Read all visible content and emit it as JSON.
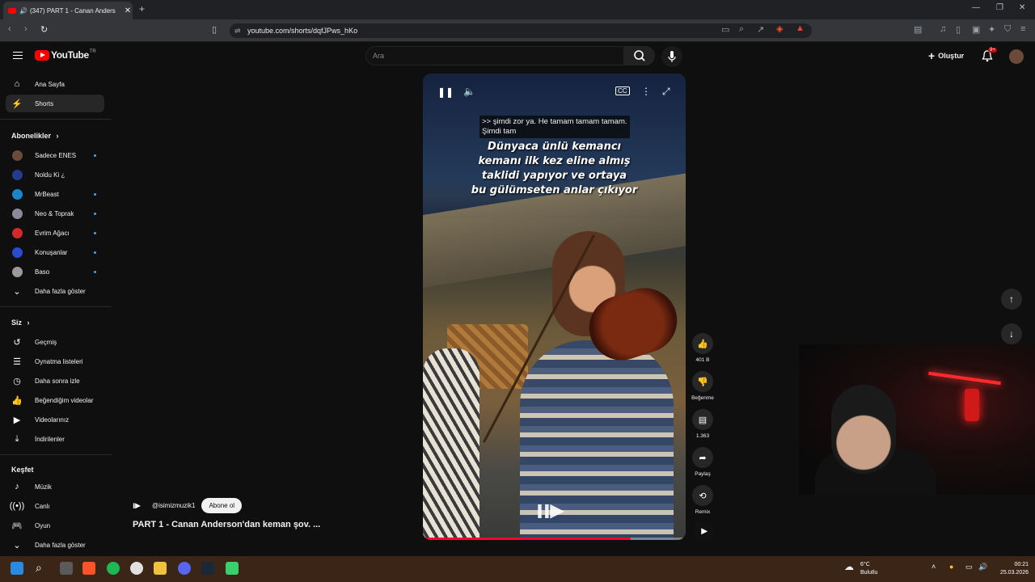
{
  "browser": {
    "tab_title": "(347) PART 1 - Canan Anders",
    "url": "youtube.com/shorts/dqfJPws_hKo"
  },
  "header": {
    "logo_text": "YouTube",
    "logo_region": "TR",
    "search_placeholder": "Ara",
    "create_label": "Oluştur",
    "notif_badge": "9+"
  },
  "sidebar": {
    "main": [
      {
        "label": "Ana Sayfa",
        "icon": "home-icon"
      },
      {
        "label": "Shorts",
        "icon": "shorts-icon"
      }
    ],
    "subs_heading": "Abonelikler",
    "subscriptions": [
      {
        "label": "Sadece ENES",
        "color": "#6a4a3a"
      },
      {
        "label": "Noldu Ki ¿",
        "color": "#243a8a"
      },
      {
        "label": "MrBeast",
        "color": "#1a88c8"
      },
      {
        "label": "Neo & Toprak",
        "color": "#8a8a9a"
      },
      {
        "label": "Evrim Ağacı",
        "color": "#d02a2a"
      },
      {
        "label": "Konuşanlar",
        "color": "#2a4ad0"
      },
      {
        "label": "Baso",
        "color": "#9a9a9a"
      }
    ],
    "show_more_1": "Daha fazla göster",
    "you_heading": "Siz",
    "you_items": [
      {
        "label": "Geçmiş",
        "icon": "history-icon"
      },
      {
        "label": "Oynatma listeleri",
        "icon": "playlist-icon"
      },
      {
        "label": "Daha sonra izle",
        "icon": "clock-icon"
      },
      {
        "label": "Beğendiğim videolar",
        "icon": "like-icon"
      },
      {
        "label": "Videolarınız",
        "icon": "video-icon"
      },
      {
        "label": "İndirilenler",
        "icon": "download-icon"
      }
    ],
    "explore_heading": "Keşfet",
    "explore_items": [
      {
        "label": "Müzik",
        "icon": "music-icon"
      },
      {
        "label": "Canlı",
        "icon": "live-icon"
      },
      {
        "label": "Oyun",
        "icon": "game-icon"
      }
    ],
    "show_more_2": "Daha fazla göster"
  },
  "video": {
    "caption": ">> şimdi zor ya. He tamam tamam tamam.\nŞimdi tam",
    "overlay_lines": [
      "Dünyaca ünlü kemancı",
      "kemanı ilk kez eline almış",
      "taklidi yapıyor ve ortaya",
      "bu gülümseten anlar çıkıyor"
    ],
    "progress": 0.79
  },
  "actions": {
    "likes": "401 B",
    "dislike": "Beğenme",
    "comments": "1.363",
    "share": "Paylaş",
    "remix": "Remix"
  },
  "channel": {
    "handle": "@isimizmuzik1",
    "subscribe_label": "Abone ol",
    "title": "PART 1 - Canan Anderson'dan keman şov. ..."
  },
  "tray": {
    "temp": "6°C",
    "weather": "Bulutlu",
    "time": "00:21",
    "date": "25.03.2026"
  }
}
